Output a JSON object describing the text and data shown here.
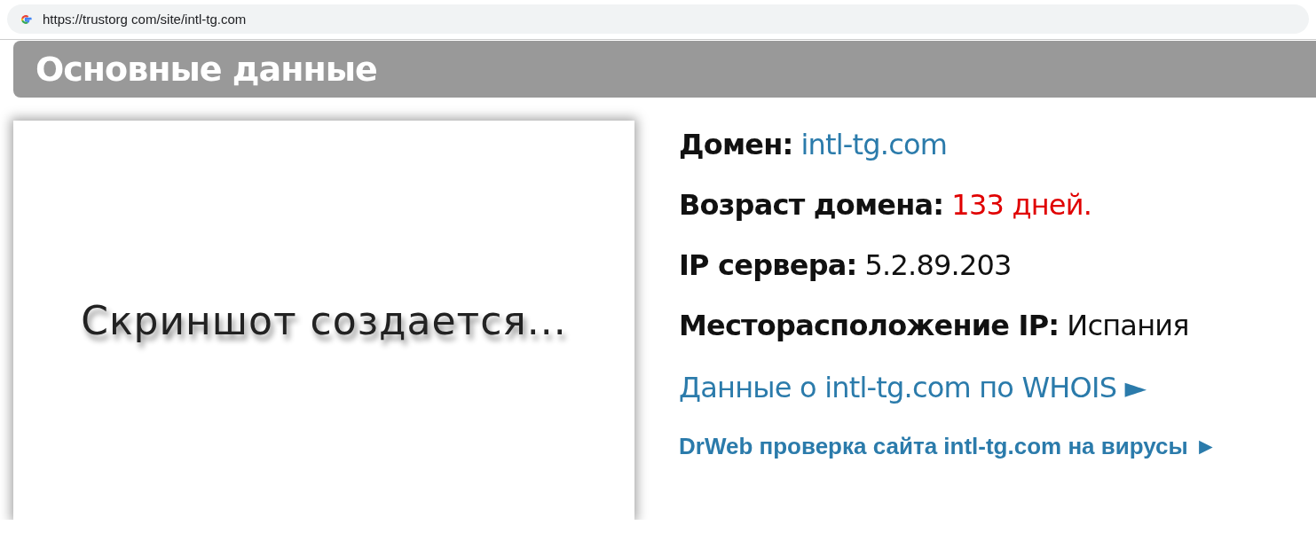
{
  "browser": {
    "url": "https://trustorg com/site/intl-tg.com"
  },
  "section": {
    "title": "Основные данные"
  },
  "screenshot": {
    "caption": "Скриншот создается..."
  },
  "info_rows": [
    {
      "label": "Домен:",
      "value": "intl-tg.com",
      "kind": "link"
    },
    {
      "label": "Возраст домена:",
      "value": "133 дней.",
      "kind": "alert"
    },
    {
      "label": "IP сервера:",
      "value": "5.2.89.203",
      "kind": "plain"
    },
    {
      "label": "Месторасположение IP:",
      "value": "Испания",
      "kind": "plain"
    }
  ],
  "links": [
    {
      "text": "Данные о intl-tg.com по WHOIS ►",
      "kind": "large"
    },
    {
      "text": "DrWeb проверка сайта intl-tg.com на вирусы ►",
      "kind": "bold"
    }
  ]
}
